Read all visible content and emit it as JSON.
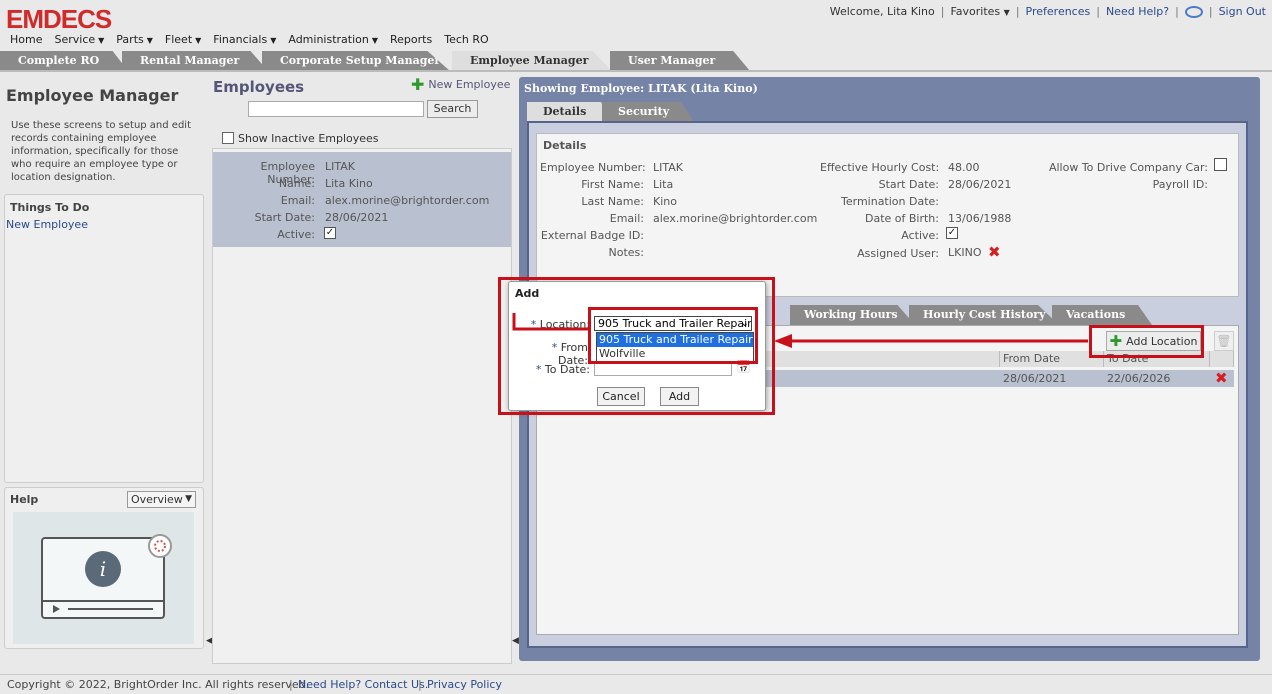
{
  "app": {
    "logo": "EMDECS"
  },
  "topbar": {
    "welcome": "Welcome, Lita Kino",
    "favorites": "Favorites",
    "preferences": "Preferences",
    "need_help": "Need Help?",
    "sign_out": "Sign Out"
  },
  "mainnav": [
    "Home",
    "Service",
    "Parts",
    "Fleet",
    "Financials",
    "Administration",
    "Reports",
    "Tech RO"
  ],
  "modules": [
    "Complete RO",
    "Rental Manager",
    "Corporate Setup Manager",
    "Employee Manager",
    "User Manager"
  ],
  "left": {
    "title": "Employee Manager",
    "description": "Use these screens to setup and edit records containing employee information, specifically for those who require an employee type or location designation.",
    "todo_title": "Things To Do",
    "todo_link": "New Employee",
    "help_title": "Help",
    "help_select": "Overview"
  },
  "employees": {
    "title": "Employees",
    "new_label": "New Employee",
    "search_btn": "Search",
    "show_inactive": "Show Inactive Employees",
    "card": {
      "number_lbl": "Employee Number:",
      "number": "LITAK",
      "name_lbl": "Name:",
      "name": "Lita Kino",
      "email_lbl": "Email:",
      "email": "alex.morine@brightorder.com",
      "start_lbl": "Start Date:",
      "start": "28/06/2021",
      "active_lbl": "Active:"
    }
  },
  "detail": {
    "title": "Showing Employee: LITAK (Lita Kino)",
    "tabs": [
      "Details",
      "Security"
    ],
    "section": "Details",
    "fields": {
      "emp_no_lbl": "Employee Number:",
      "emp_no": "LITAK",
      "first_lbl": "First Name:",
      "first": "Lita",
      "last_lbl": "Last Name:",
      "last": "Kino",
      "email_lbl": "Email:",
      "email": "alex.morine@brightorder.com",
      "badge_lbl": "External Badge ID:",
      "notes_lbl": "Notes:",
      "cost_lbl": "Effective Hourly Cost:",
      "cost": "48.00",
      "start_lbl": "Start Date:",
      "start": "28/06/2021",
      "term_lbl": "Termination Date:",
      "dob_lbl": "Date of Birth:",
      "dob": "13/06/1988",
      "active_lbl": "Active:",
      "user_lbl": "Assigned User:",
      "user": "LKINO",
      "car_lbl": "Allow To Drive Company Car:",
      "payroll_lbl": "Payroll ID:"
    },
    "lower_tabs": [
      "Working Hours",
      "Hourly Cost History",
      "Vacations"
    ],
    "add_location": "Add Location",
    "grid": {
      "headers": [
        "From Date",
        "To Date"
      ],
      "row": {
        "from": "28/06/2021",
        "to": "22/06/2026"
      }
    }
  },
  "dialog": {
    "title": "Add",
    "location_lbl": "Location:",
    "from_lbl": "From Date:",
    "to_lbl": "To Date:",
    "location_value": "905 Truck and Trailer Repair",
    "options": [
      "905 Truck and Trailer Repair",
      "Wolfville"
    ],
    "cancel": "Cancel",
    "add": "Add"
  },
  "footer": {
    "copyright": "Copyright © 2022, BrightOrder Inc. All rights reserved.",
    "help": "Need Help? Contact Us.",
    "privacy": "Privacy Policy"
  },
  "colors": {
    "brand_red": "#d02a2a",
    "panel_blue": "#7584a6",
    "highlight": "#c8101a"
  }
}
